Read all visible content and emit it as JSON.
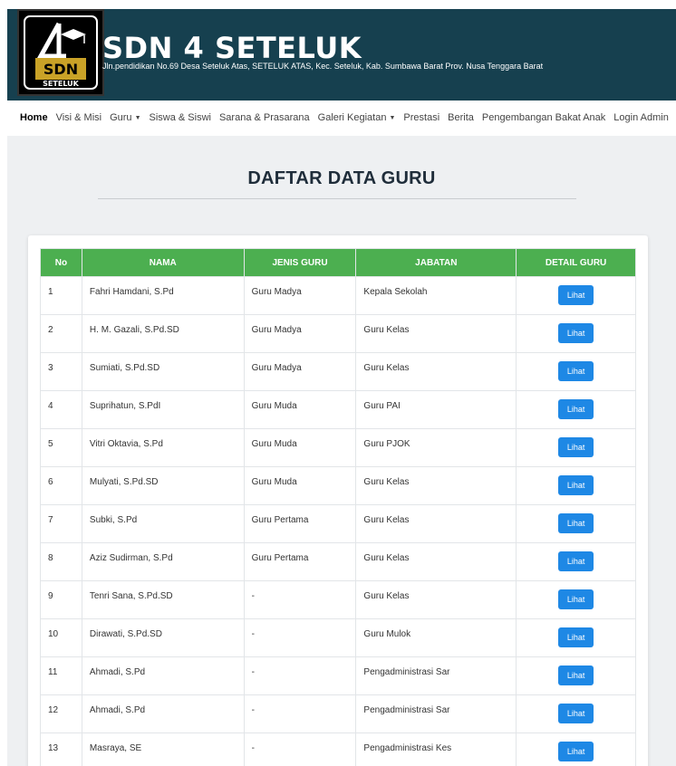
{
  "header": {
    "title": "SDN 4 SETELUK",
    "address": "Jln.pendidikan No.69 Desa Seteluk Atas, SETELUK ATAS, Kec. Seteluk, Kab. Sumbawa Barat Prov. Nusa Tenggara Barat",
    "logo_text": "SDN",
    "logo_subtext": "SETELUK"
  },
  "nav": {
    "items": [
      {
        "label": "Home",
        "active": true
      },
      {
        "label": "Visi & Misi"
      },
      {
        "label": "Guru",
        "dropdown": true
      },
      {
        "label": "Siswa & Siswi"
      },
      {
        "label": "Sarana & Prasarana"
      },
      {
        "label": "Galeri Kegiatan",
        "dropdown": true
      },
      {
        "label": "Prestasi"
      },
      {
        "label": "Berita"
      },
      {
        "label": "Pengembangan Bakat Anak"
      },
      {
        "label": "Login Admin"
      }
    ]
  },
  "page": {
    "title": "DAFTAR DATA GURU"
  },
  "table": {
    "headers": [
      "No",
      "NAMA",
      "JENIS GURU",
      "JABATAN",
      "DETAIL GURU"
    ],
    "button_label": "Lihat",
    "rows": [
      {
        "no": "1",
        "nama": "Fahri Hamdani, S.Pd",
        "jenis": "Guru Madya",
        "jabatan": "Kepala Sekolah"
      },
      {
        "no": "2",
        "nama": "H. M. Gazali, S.Pd.SD",
        "jenis": "Guru Madya",
        "jabatan": "Guru Kelas"
      },
      {
        "no": "3",
        "nama": "Sumiati, S.Pd.SD",
        "jenis": "Guru Madya",
        "jabatan": "Guru Kelas"
      },
      {
        "no": "4",
        "nama": "Suprihatun, S.PdI",
        "jenis": "Guru Muda",
        "jabatan": "Guru PAI"
      },
      {
        "no": "5",
        "nama": "Vitri Oktavia, S.Pd",
        "jenis": "Guru Muda",
        "jabatan": "Guru PJOK"
      },
      {
        "no": "6",
        "nama": "Mulyati, S.Pd.SD",
        "jenis": "Guru Muda",
        "jabatan": "Guru Kelas"
      },
      {
        "no": "7",
        "nama": "Subki, S.Pd",
        "jenis": "Guru Pertama",
        "jabatan": "Guru Kelas"
      },
      {
        "no": "8",
        "nama": "Aziz Sudirman, S.Pd",
        "jenis": "Guru Pertama",
        "jabatan": "Guru Kelas"
      },
      {
        "no": "9",
        "nama": "Tenri Sana, S.Pd.SD",
        "jenis": "-",
        "jabatan": "Guru Kelas"
      },
      {
        "no": "10",
        "nama": "Dirawati, S.Pd.SD",
        "jenis": "-",
        "jabatan": "Guru Mulok"
      },
      {
        "no": "11",
        "nama": "Ahmadi, S.Pd",
        "jenis": "-",
        "jabatan": "Pengadministrasi Sar"
      },
      {
        "no": "12",
        "nama": "Ahmadi, S.Pd",
        "jenis": "-",
        "jabatan": "Pengadministrasi Sar"
      },
      {
        "no": "13",
        "nama": "Masraya, SE",
        "jenis": "-",
        "jabatan": "Pengadministrasi Kes"
      }
    ]
  },
  "colors": {
    "header_bg": "#16404f",
    "table_header": "#4caf50",
    "button": "#1e88e5",
    "content_bg": "#eef0f2"
  }
}
